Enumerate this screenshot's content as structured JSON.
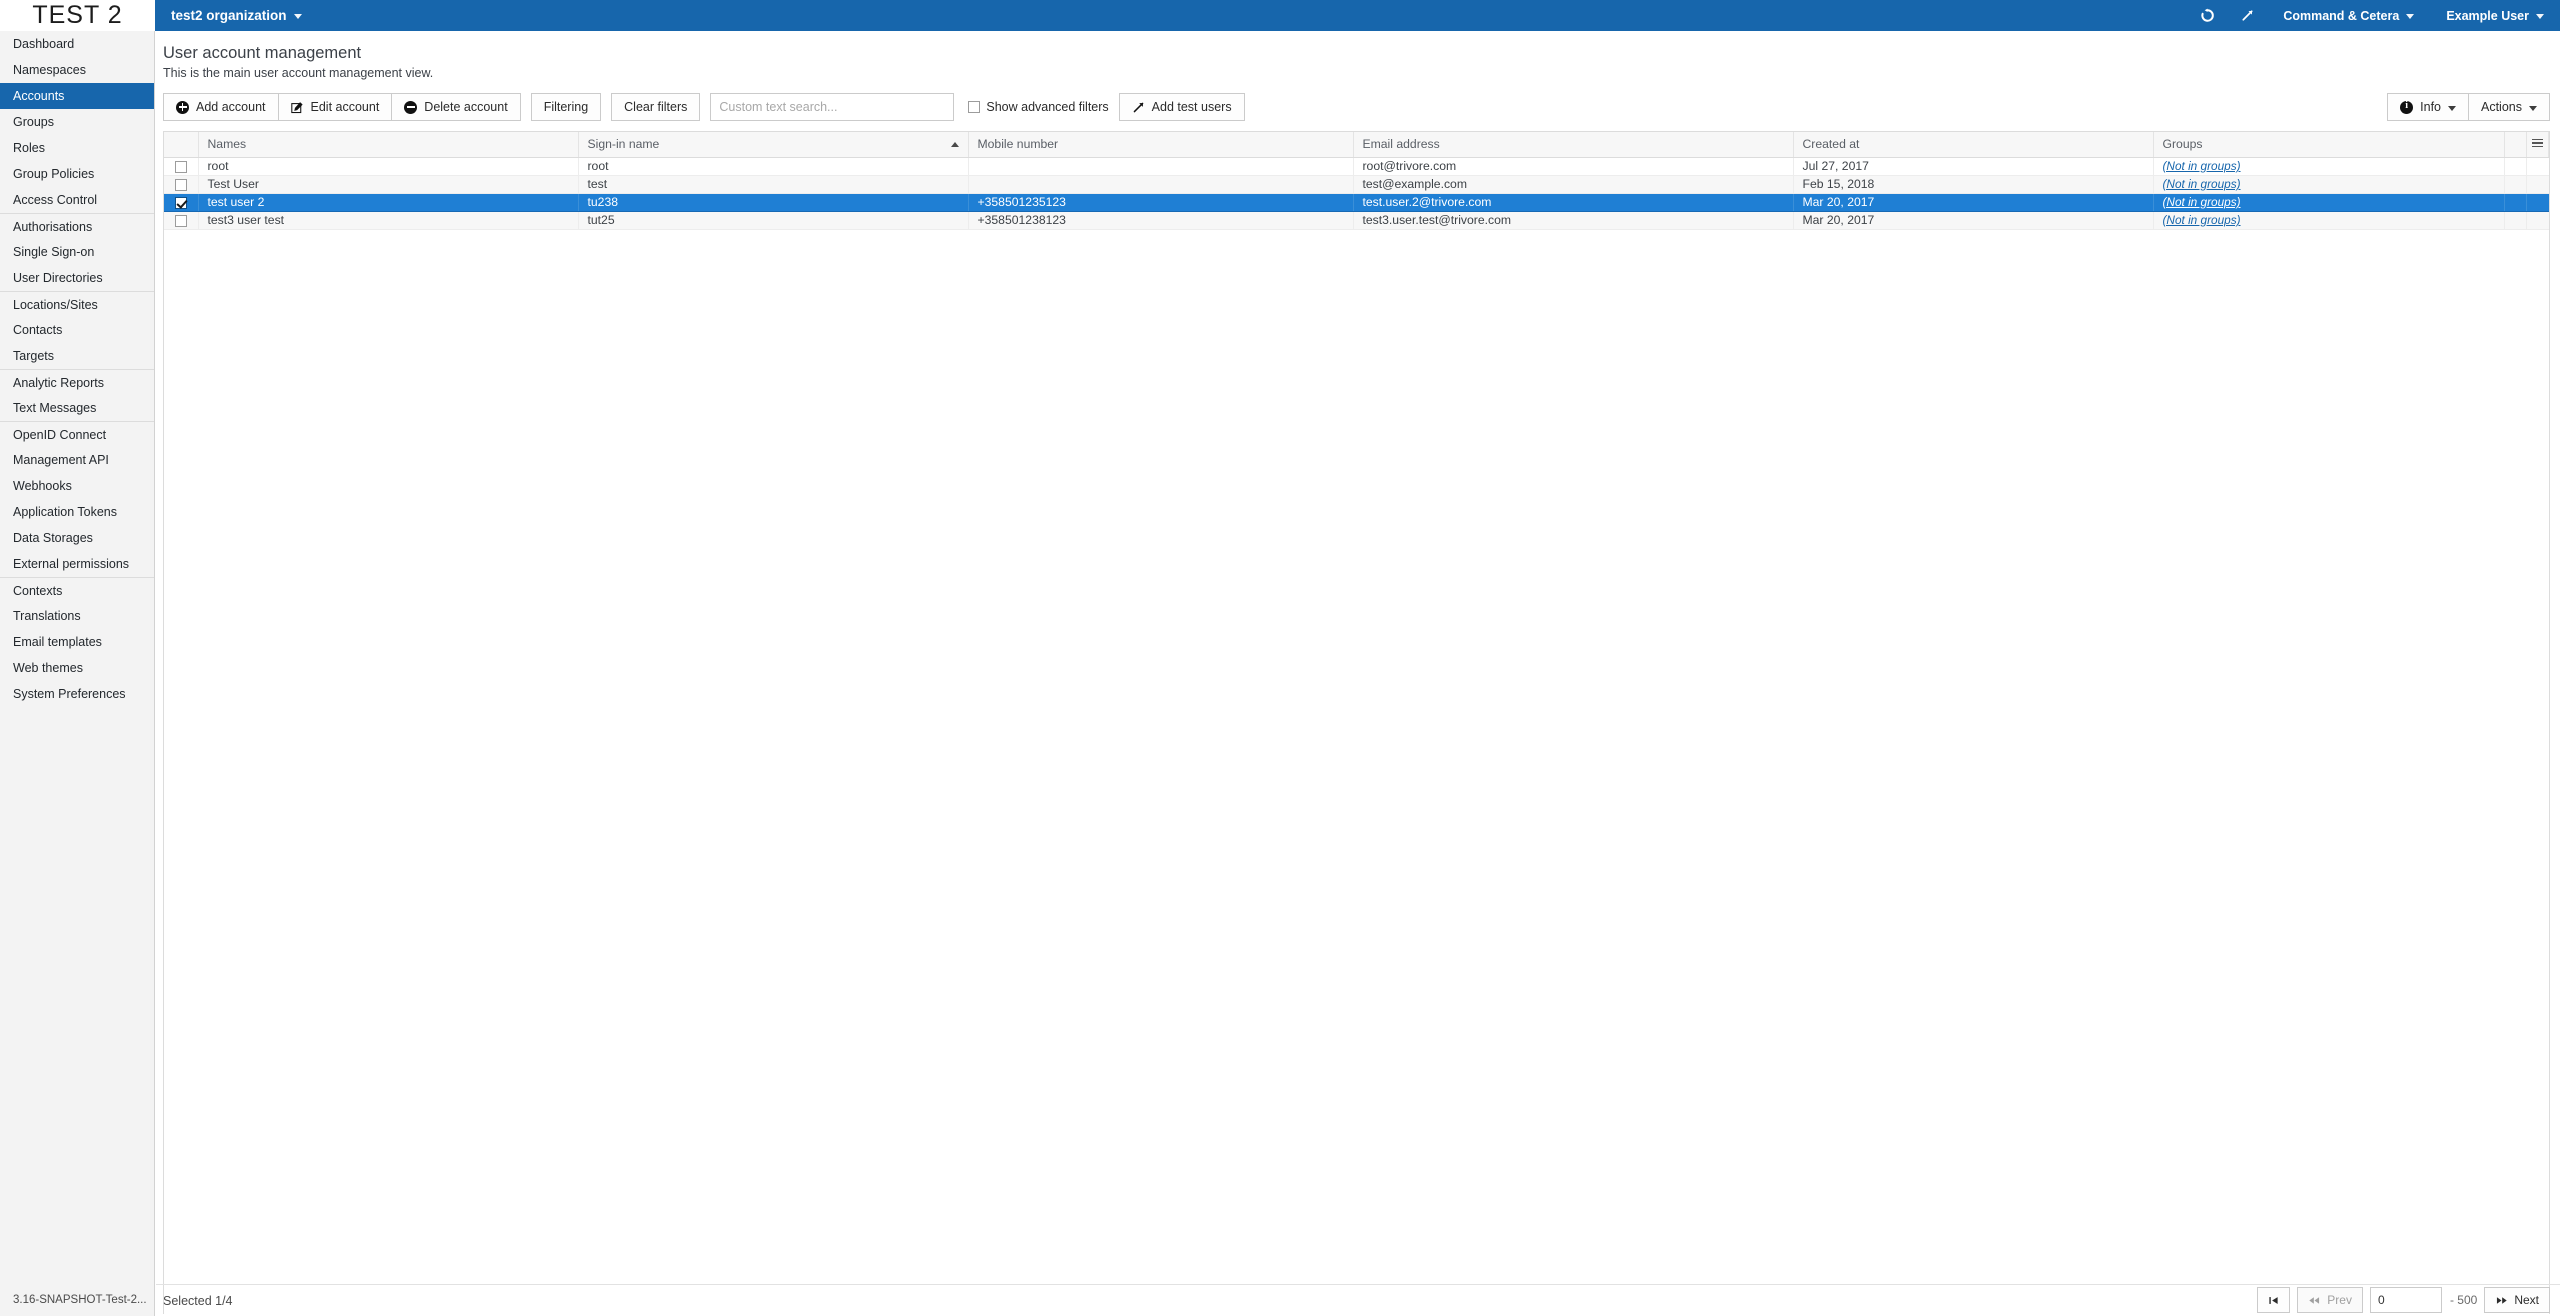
{
  "topbar": {
    "brand": "TEST 2",
    "organization": "test2 organization",
    "refresh_icon": "refresh-icon",
    "expand_icon": "expand-diagonal-icon",
    "command_menu": "Command & Cetera",
    "user_menu": "Example User"
  },
  "sidebar": {
    "version": "3.16-SNAPSHOT-Test-2...",
    "items": [
      {
        "label": "Dashboard",
        "active": false,
        "sep": false
      },
      {
        "label": "Namespaces",
        "active": false,
        "sep": false
      },
      {
        "label": "Accounts",
        "active": true,
        "sep": false
      },
      {
        "label": "Groups",
        "active": false,
        "sep": false
      },
      {
        "label": "Roles",
        "active": false,
        "sep": false
      },
      {
        "label": "Group Policies",
        "active": false,
        "sep": false
      },
      {
        "label": "Access Control",
        "active": false,
        "sep": false
      },
      {
        "label": "Authorisations",
        "active": false,
        "sep": true
      },
      {
        "label": "Single Sign-on",
        "active": false,
        "sep": false
      },
      {
        "label": "User Directories",
        "active": false,
        "sep": false
      },
      {
        "label": "Locations/Sites",
        "active": false,
        "sep": true
      },
      {
        "label": "Contacts",
        "active": false,
        "sep": false
      },
      {
        "label": "Targets",
        "active": false,
        "sep": false
      },
      {
        "label": "Analytic Reports",
        "active": false,
        "sep": true
      },
      {
        "label": "Text Messages",
        "active": false,
        "sep": false
      },
      {
        "label": "OpenID Connect",
        "active": false,
        "sep": true
      },
      {
        "label": "Management API",
        "active": false,
        "sep": false
      },
      {
        "label": "Webhooks",
        "active": false,
        "sep": false
      },
      {
        "label": "Application Tokens",
        "active": false,
        "sep": false
      },
      {
        "label": "Data Storages",
        "active": false,
        "sep": false
      },
      {
        "label": "External permissions",
        "active": false,
        "sep": false
      },
      {
        "label": "Contexts",
        "active": false,
        "sep": true
      },
      {
        "label": "Translations",
        "active": false,
        "sep": false
      },
      {
        "label": "Email templates",
        "active": false,
        "sep": false
      },
      {
        "label": "Web themes",
        "active": false,
        "sep": false
      },
      {
        "label": "System Preferences",
        "active": false,
        "sep": false
      }
    ]
  },
  "page": {
    "title": "User account management",
    "subtitle": "This is the main user account management view."
  },
  "toolbar": {
    "add_account": "Add account",
    "edit_account": "Edit account",
    "delete_account": "Delete account",
    "filtering": "Filtering",
    "clear_filters": "Clear filters",
    "search_value": "",
    "search_placeholder": "Custom text search...",
    "show_advanced_filters": "Show advanced filters",
    "show_advanced_filters_checked": false,
    "add_test_users": "Add test users",
    "info": "Info",
    "actions": "Actions"
  },
  "table": {
    "columns": [
      {
        "key": "names",
        "label": "Names",
        "sorted": ""
      },
      {
        "key": "signin",
        "label": "Sign-in name",
        "sorted": "asc"
      },
      {
        "key": "mobile",
        "label": "Mobile number",
        "sorted": ""
      },
      {
        "key": "email",
        "label": "Email address",
        "sorted": ""
      },
      {
        "key": "created",
        "label": "Created at",
        "sorted": ""
      },
      {
        "key": "groups",
        "label": "Groups",
        "sorted": ""
      }
    ],
    "column_menu_icon": "hamburger-menu-icon",
    "rows": [
      {
        "selected": false,
        "checked": false,
        "names": "root",
        "signin": "root",
        "mobile": "",
        "email": "root@trivore.com",
        "created": "Jul 27, 2017",
        "groups": "(Not in groups)"
      },
      {
        "selected": false,
        "checked": false,
        "names": "Test User",
        "signin": "test",
        "mobile": "",
        "email": "test@example.com",
        "created": "Feb 15, 2018",
        "groups": "(Not in groups)"
      },
      {
        "selected": true,
        "checked": true,
        "names": "test user 2",
        "signin": "tu238",
        "mobile": "+358501235123",
        "email": "test.user.2@trivore.com",
        "created": "Mar 20, 2017",
        "groups": "(Not in groups)"
      },
      {
        "selected": false,
        "checked": false,
        "names": "test3 user test",
        "signin": "tut25",
        "mobile": "+358501238123",
        "email": "test3.user.test@trivore.com",
        "created": "Mar 20, 2017",
        "groups": "(Not in groups)"
      }
    ]
  },
  "footer": {
    "selected_label": "Selected 1/4",
    "first_label": "",
    "prev_label": "Prev",
    "page_value": "0",
    "page_total": "- 500",
    "next_label": "Next"
  },
  "colors": {
    "brand_blue": "#1766ac",
    "selection_blue": "#1f7fd4",
    "link_blue": "#1766ac"
  }
}
